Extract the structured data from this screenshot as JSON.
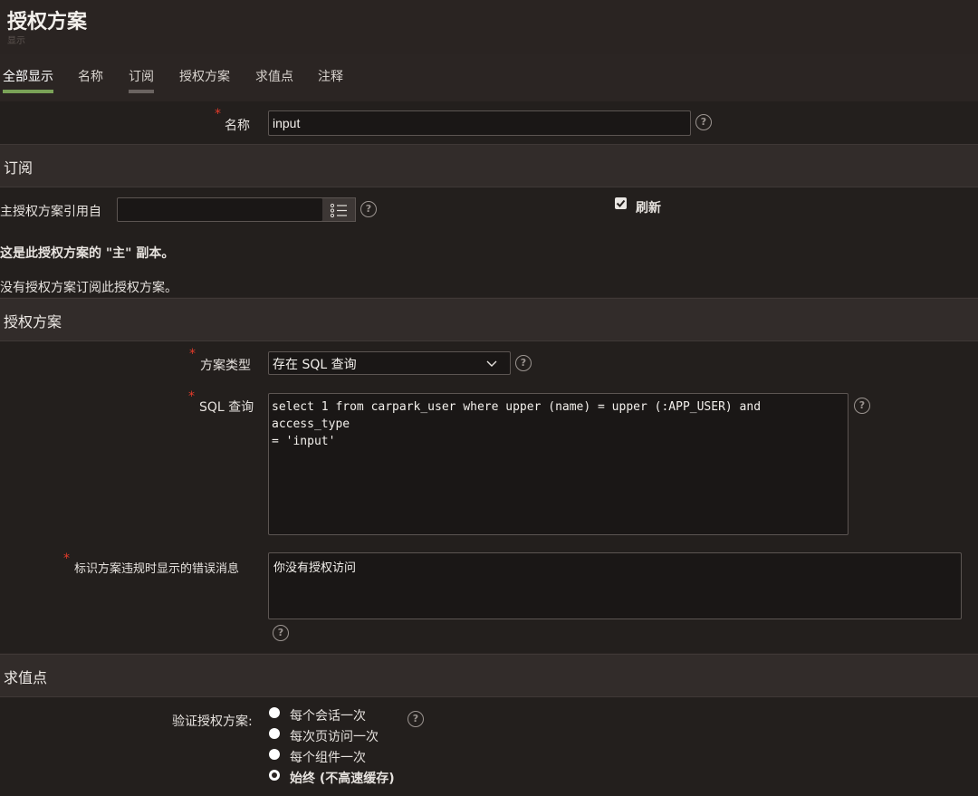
{
  "header": {
    "title": "授权方案",
    "subtitle": "显示"
  },
  "tabs": [
    {
      "label": "全部显示"
    },
    {
      "label": "名称"
    },
    {
      "label": "订阅"
    },
    {
      "label": "授权方案"
    },
    {
      "label": "求值点"
    },
    {
      "label": "注释"
    }
  ],
  "name_field": {
    "label": "名称",
    "value": "input"
  },
  "subscription": {
    "title": "订阅",
    "ref_label": "主授权方案引用自",
    "ref_value": "",
    "refresh_label": "刷新",
    "master_note": "这是此授权方案的 \"主\" 副本。",
    "no_sub_note": "没有授权方案订阅此授权方案。"
  },
  "scheme": {
    "title": "授权方案",
    "type_label": "方案类型",
    "type_value": "存在 SQL 查询",
    "sql_label": "SQL 查询",
    "sql_value": "select 1 from carpark_user where upper (name) = upper (:APP_USER) and access_type\n= 'input'",
    "error_label": "标识方案违规时显示的错误消息",
    "error_value": "你没有授权访问"
  },
  "evaluation": {
    "title": "求值点",
    "validate_label": "验证授权方案:",
    "options": [
      {
        "label": "每个会话一次"
      },
      {
        "label": "每次页访问一次"
      },
      {
        "label": "每个组件一次"
      },
      {
        "label": "始终 (不高速缓存)"
      }
    ]
  },
  "colors": {
    "accent": "#7aa257",
    "required": "#e23b2a",
    "background": "#2b2523"
  }
}
